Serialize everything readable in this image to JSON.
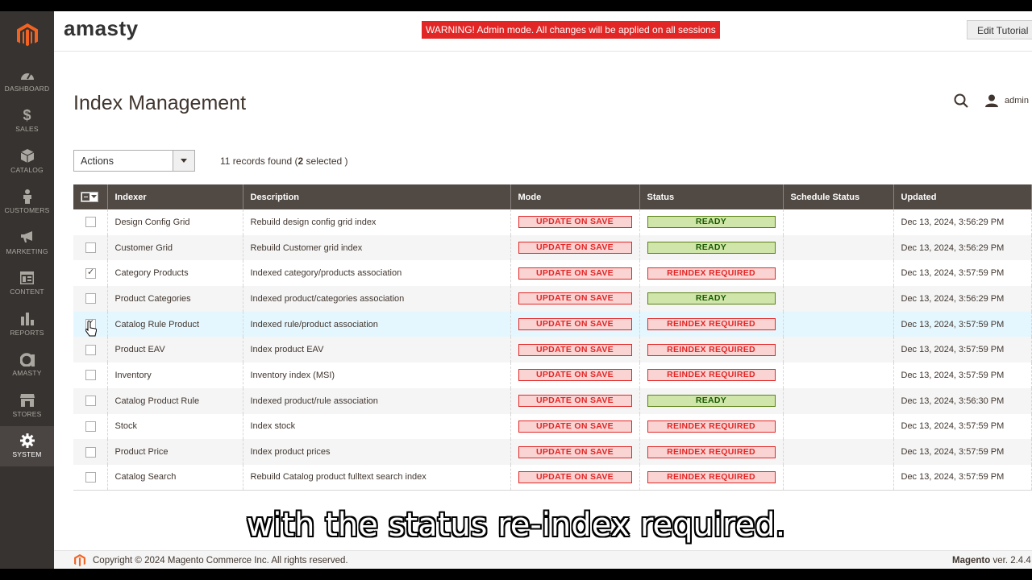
{
  "sidebar": {
    "items": [
      {
        "label": "DASHBOARD",
        "icon": "speedometer-icon"
      },
      {
        "label": "SALES",
        "icon": "dollar-icon"
      },
      {
        "label": "CATALOG",
        "icon": "cube-icon"
      },
      {
        "label": "CUSTOMERS",
        "icon": "person-icon"
      },
      {
        "label": "MARKETING",
        "icon": "megaphone-icon"
      },
      {
        "label": "CONTENT",
        "icon": "layout-icon"
      },
      {
        "label": "REPORTS",
        "icon": "bar-chart-icon"
      },
      {
        "label": "AMASTY",
        "icon": "amasty-icon"
      },
      {
        "label": "STORES",
        "icon": "storefront-icon"
      },
      {
        "label": "SYSTEM",
        "icon": "gear-icon"
      }
    ],
    "active": "SYSTEM"
  },
  "header": {
    "brand": "amasty",
    "warning": "WARNING! Admin mode. All changes will be applied on all sessions",
    "edit_button": "Edit Tutorial"
  },
  "page": {
    "title": "Index Management",
    "user": "admin",
    "actions_label": "Actions",
    "records_prefix": "11 records found (",
    "records_selected": "2",
    "records_suffix": " selected )"
  },
  "grid": {
    "columns": [
      "Indexer",
      "Description",
      "Mode",
      "Status",
      "Schedule Status",
      "Updated"
    ],
    "rows": [
      {
        "indexer": "Design Config Grid",
        "description": "Rebuild design config grid index",
        "mode": "UPDATE ON SAVE",
        "status": "READY",
        "schedule": "",
        "updated": "Dec 13, 2024, 3:56:29 PM",
        "checked": false
      },
      {
        "indexer": "Customer Grid",
        "description": "Rebuild Customer grid index",
        "mode": "UPDATE ON SAVE",
        "status": "READY",
        "schedule": "",
        "updated": "Dec 13, 2024, 3:56:29 PM",
        "checked": false
      },
      {
        "indexer": "Category Products",
        "description": "Indexed category/products association",
        "mode": "UPDATE ON SAVE",
        "status": "REINDEX REQUIRED",
        "schedule": "",
        "updated": "Dec 13, 2024, 3:57:59 PM",
        "checked": true
      },
      {
        "indexer": "Product Categories",
        "description": "Indexed product/categories association",
        "mode": "UPDATE ON SAVE",
        "status": "READY",
        "schedule": "",
        "updated": "Dec 13, 2024, 3:56:29 PM",
        "checked": false
      },
      {
        "indexer": "Catalog Rule Product",
        "description": "Indexed rule/product association",
        "mode": "UPDATE ON SAVE",
        "status": "REINDEX REQUIRED",
        "schedule": "",
        "updated": "Dec 13, 2024, 3:57:59 PM",
        "checked": true
      },
      {
        "indexer": "Product EAV",
        "description": "Index product EAV",
        "mode": "UPDATE ON SAVE",
        "status": "REINDEX REQUIRED",
        "schedule": "",
        "updated": "Dec 13, 2024, 3:57:59 PM",
        "checked": false
      },
      {
        "indexer": "Inventory",
        "description": "Inventory index (MSI)",
        "mode": "UPDATE ON SAVE",
        "status": "REINDEX REQUIRED",
        "schedule": "",
        "updated": "Dec 13, 2024, 3:57:59 PM",
        "checked": false
      },
      {
        "indexer": "Catalog Product Rule",
        "description": "Indexed product/rule association",
        "mode": "UPDATE ON SAVE",
        "status": "READY",
        "schedule": "",
        "updated": "Dec 13, 2024, 3:56:30 PM",
        "checked": false
      },
      {
        "indexer": "Stock",
        "description": "Index stock",
        "mode": "UPDATE ON SAVE",
        "status": "REINDEX REQUIRED",
        "schedule": "",
        "updated": "Dec 13, 2024, 3:57:59 PM",
        "checked": false
      },
      {
        "indexer": "Product Price",
        "description": "Index product prices",
        "mode": "UPDATE ON SAVE",
        "status": "REINDEX REQUIRED",
        "schedule": "",
        "updated": "Dec 13, 2024, 3:57:59 PM",
        "checked": false
      },
      {
        "indexer": "Catalog Search",
        "description": "Rebuild Catalog product fulltext search index",
        "mode": "UPDATE ON SAVE",
        "status": "REINDEX REQUIRED",
        "schedule": "",
        "updated": "Dec 13, 2024, 3:57:59 PM",
        "checked": false
      }
    ]
  },
  "subtitle": "with the status re-index required.",
  "footer": {
    "copyright": "Copyright © 2024 Magento Commerce Inc. All rights reserved.",
    "brand": "Magento",
    "version": " ver. 2.4.4"
  },
  "colors": {
    "sidebar_bg": "#373330",
    "accent": "#f26322",
    "grid_header": "#514943",
    "warning": "#e22626",
    "ready": "#d0e5a9"
  }
}
